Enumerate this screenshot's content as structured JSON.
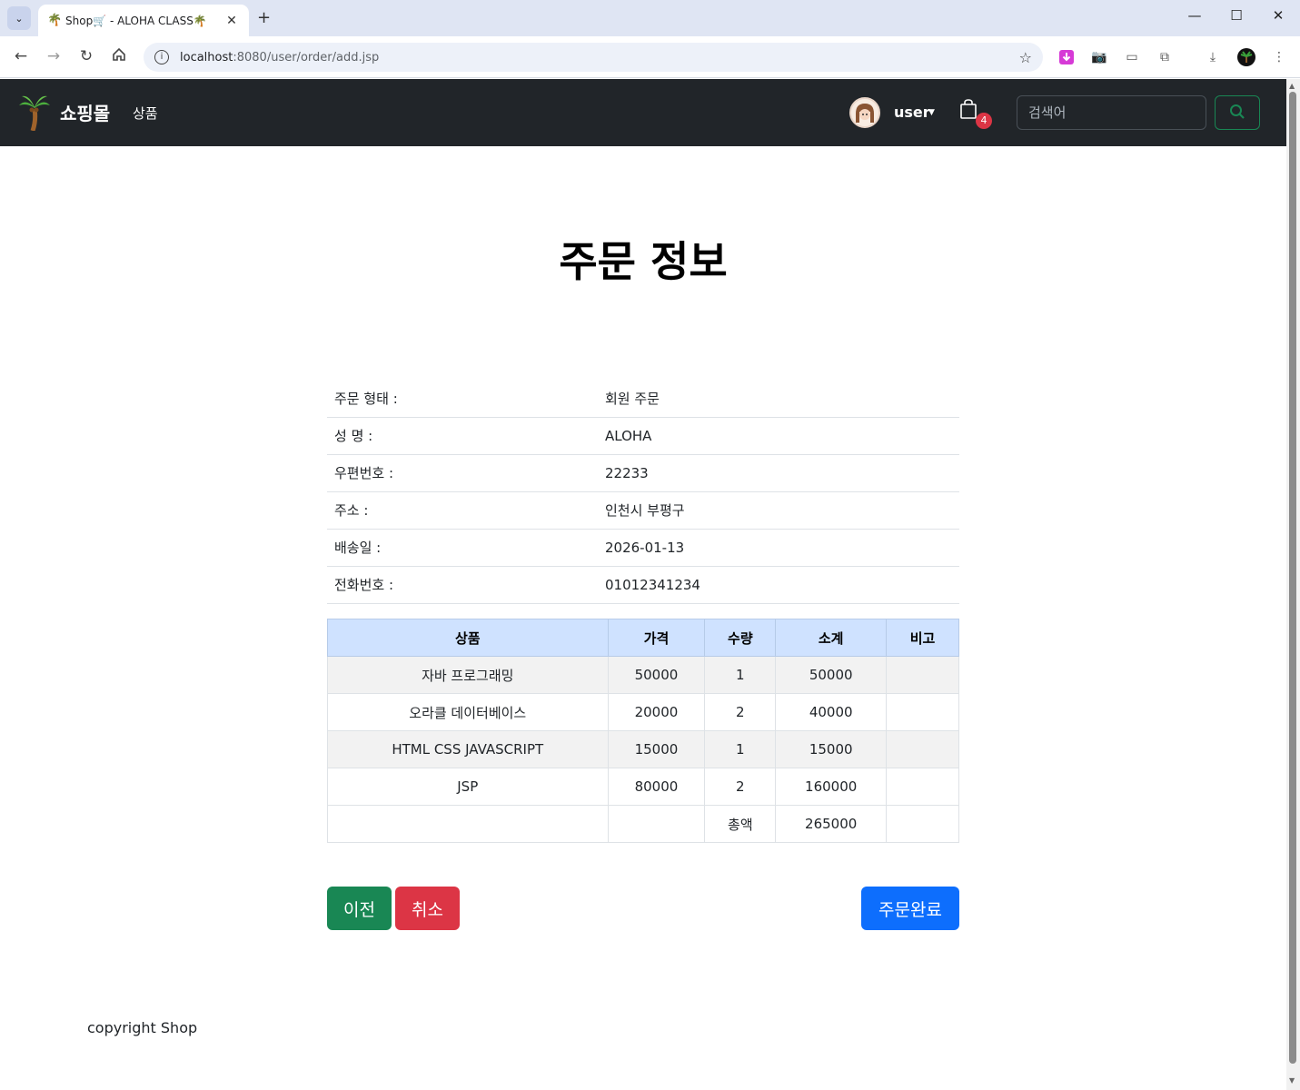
{
  "browser": {
    "tab_title": "Shop🛒 - ALOHA CLASS🌴",
    "url_host": "localhost",
    "url_rest": ":8080/user/order/add.jsp"
  },
  "navbar": {
    "brand": "쇼핑몰",
    "link_products": "상품",
    "username": "user",
    "cart_count": "4",
    "search_placeholder": "검색어"
  },
  "page": {
    "title": "주문 정보"
  },
  "order_info": [
    {
      "label": "주문 형태 :",
      "value": "회원 주문"
    },
    {
      "label": "성 명 :",
      "value": "ALOHA"
    },
    {
      "label": "우편번호 :",
      "value": "22233"
    },
    {
      "label": "주소 :",
      "value": "인천시 부평구"
    },
    {
      "label": "배송일 :",
      "value": "2026-01-13"
    },
    {
      "label": "전화번호 :",
      "value": "01012341234"
    }
  ],
  "cart_table": {
    "headers": [
      "상품",
      "가격",
      "수량",
      "소계",
      "비고"
    ],
    "rows": [
      [
        "자바 프로그래밍",
        "50000",
        "1",
        "50000",
        ""
      ],
      [
        "오라클 데이터베이스",
        "20000",
        "2",
        "40000",
        ""
      ],
      [
        "HTML CSS JAVASCRIPT",
        "15000",
        "1",
        "15000",
        ""
      ],
      [
        "JSP",
        "80000",
        "2",
        "160000",
        ""
      ]
    ],
    "total_label": "총액",
    "total_value": "265000"
  },
  "buttons": {
    "prev": "이전",
    "cancel": "취소",
    "submit": "주문완료"
  },
  "footer": {
    "text": "copyright Shop"
  }
}
